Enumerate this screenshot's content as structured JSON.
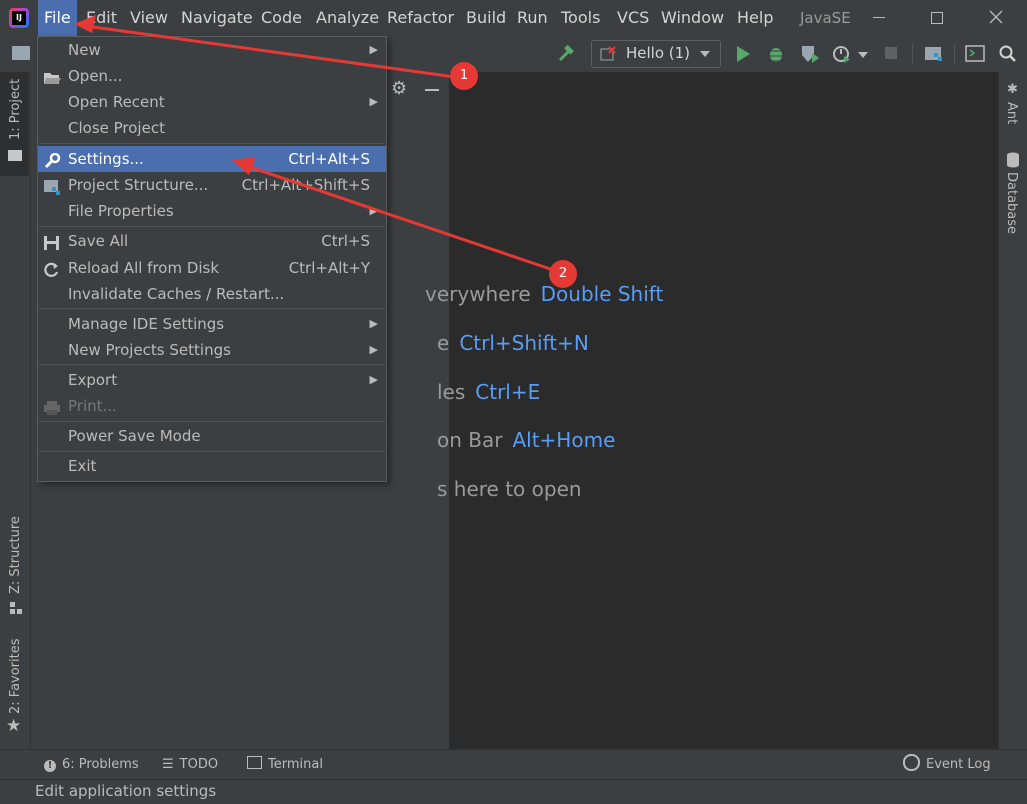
{
  "app": {
    "logo": "IJ",
    "project_name": "JavaSE"
  },
  "menubar": [
    {
      "label": "File"
    },
    {
      "label": "Edit"
    },
    {
      "label": "View"
    },
    {
      "label": "Navigate"
    },
    {
      "label": "Code"
    },
    {
      "label": "Analyze"
    },
    {
      "label": "Refactor"
    },
    {
      "label": "Build"
    },
    {
      "label": "Run"
    },
    {
      "label": "Tools"
    },
    {
      "label": "VCS"
    },
    {
      "label": "Window"
    },
    {
      "label": "Help"
    }
  ],
  "toolbar": {
    "run_config": "Hello (1)"
  },
  "left_strip": {
    "project_tab": "1: Project",
    "structure_tab": "Z: Structure",
    "favorites_tab": "2: Favorites"
  },
  "right_strip": {
    "ant_tab": "Ant",
    "database_tab": "Database"
  },
  "file_menu": {
    "items": [
      {
        "label": "New",
        "shortcut": "",
        "submenu": true
      },
      {
        "label": "Open...",
        "shortcut": ""
      },
      {
        "label": "Open Recent",
        "shortcut": "",
        "submenu": true
      },
      {
        "label": "Close Project",
        "shortcut": ""
      },
      {
        "label": "Settings...",
        "shortcut": "Ctrl+Alt+S"
      },
      {
        "label": "Project Structure...",
        "shortcut": "Ctrl+Alt+Shift+S"
      },
      {
        "label": "File Properties",
        "shortcut": "",
        "submenu": true
      },
      {
        "label": "Save All",
        "shortcut": "Ctrl+S"
      },
      {
        "label": "Reload All from Disk",
        "shortcut": "Ctrl+Alt+Y"
      },
      {
        "label": "Invalidate Caches / Restart...",
        "shortcut": ""
      },
      {
        "label": "Manage IDE Settings",
        "shortcut": "",
        "submenu": true
      },
      {
        "label": "New Projects Settings",
        "shortcut": "",
        "submenu": true
      },
      {
        "label": "Export",
        "shortcut": "",
        "submenu": true
      },
      {
        "label": "Print...",
        "shortcut": ""
      },
      {
        "label": "Power Save Mode",
        "shortcut": ""
      },
      {
        "label": "Exit",
        "shortcut": ""
      }
    ]
  },
  "editor_hints": [
    {
      "text": "verywhere",
      "key": "Double Shift"
    },
    {
      "text": "e",
      "key": "Ctrl+Shift+N"
    },
    {
      "text": "les",
      "key": "Ctrl+E"
    },
    {
      "text": "on Bar",
      "key": "Alt+Home"
    },
    {
      "text": "s here to open",
      "key": ""
    }
  ],
  "annotations": {
    "badge1": "1",
    "badge2": "2"
  },
  "bottom_tabs": {
    "problems": "6: Problems",
    "todo": "TODO",
    "terminal": "Terminal",
    "event_log": "Event Log"
  },
  "status": {
    "text": "Edit application settings"
  },
  "colors": {
    "accent": "#4b6eaf",
    "link": "#589df6",
    "annotation": "#e53935"
  }
}
